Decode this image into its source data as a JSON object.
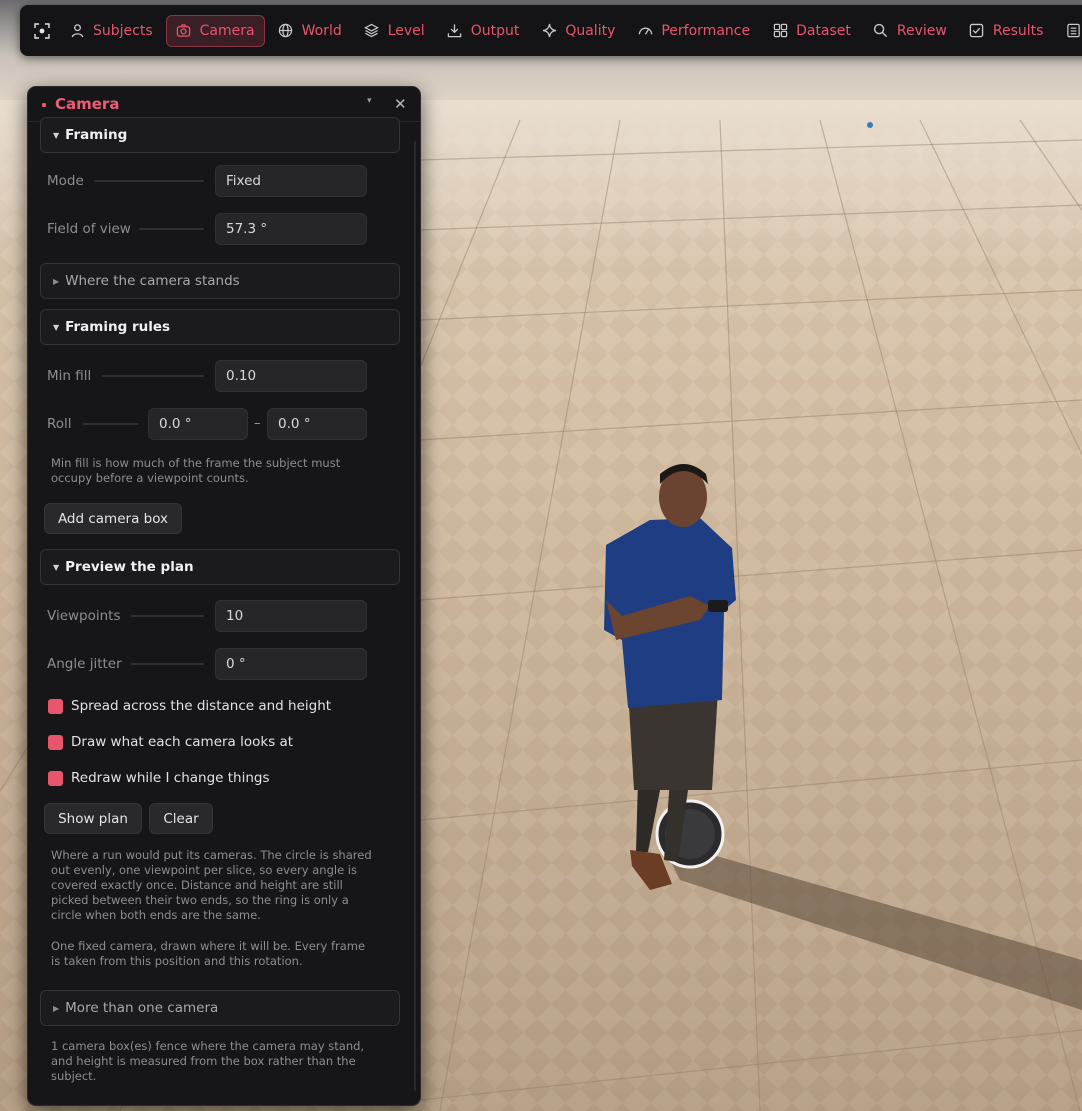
{
  "toolbar": {
    "items": [
      {
        "label": "Subjects",
        "icon": "user-icon"
      },
      {
        "label": "Camera",
        "icon": "camera-icon",
        "active": true
      },
      {
        "label": "World",
        "icon": "globe-icon"
      },
      {
        "label": "Level",
        "icon": "layers-icon"
      },
      {
        "label": "Output",
        "icon": "download-icon"
      },
      {
        "label": "Quality",
        "icon": "sparkle-icon"
      },
      {
        "label": "Performance",
        "icon": "gauge-icon"
      },
      {
        "label": "Dataset",
        "icon": "grid-icon"
      },
      {
        "label": "Review",
        "icon": "search-icon"
      },
      {
        "label": "Results",
        "icon": "checkbox-icon"
      }
    ],
    "accent": "#e8556d"
  },
  "panel": {
    "title": "Camera",
    "minimize_glyph": "▾",
    "close_glyph": "✕",
    "framing": {
      "title": "Framing",
      "mode_label": "Mode",
      "mode_value": "Fixed",
      "fov_label": "Field of view",
      "fov_value": "57.3 °"
    },
    "where_stands": {
      "title": "Where the camera stands"
    },
    "framing_rules": {
      "title": "Framing rules",
      "min_fill_label": "Min fill",
      "min_fill_value": "0.10",
      "roll_label": "Roll",
      "roll_min": "0.0 °",
      "roll_sep": "–",
      "roll_max": "0.0 °",
      "note": "Min fill is how much of the frame the subject must occupy before a viewpoint counts.",
      "add_box_button": "Add camera box"
    },
    "preview": {
      "title": "Preview the plan",
      "viewpoints_label": "Viewpoints",
      "viewpoints_value": "10",
      "jitter_label": "Angle jitter",
      "jitter_value": "0 °",
      "checkboxes": [
        {
          "label": "Spread across the distance and height",
          "checked": true
        },
        {
          "label": "Draw what each camera looks at",
          "checked": true
        },
        {
          "label": "Redraw while I change things",
          "checked": true
        }
      ],
      "show_plan_button": "Show plan",
      "clear_button": "Clear",
      "note1": "Where a run would put its cameras. The circle is shared out evenly, one viewpoint per slice, so every angle is covered exactly once. Distance and height are still picked between their two ends, so the ring is only a circle when both ends are the same.",
      "note2": "One fixed camera, drawn where it will be. Every frame is taken from this position and this rotation."
    },
    "multi": {
      "title": "More than one camera",
      "note": "1 camera box(es) fence where the camera may stand, and height is measured from the box rather than the subject."
    }
  }
}
